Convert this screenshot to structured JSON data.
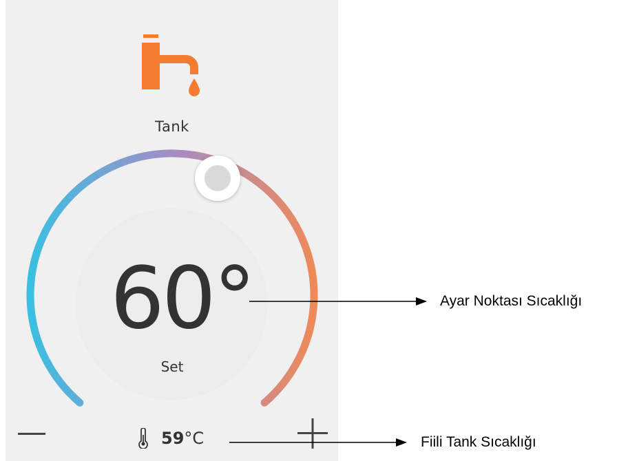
{
  "zone": {
    "name": "Tank",
    "icon": "faucet-icon"
  },
  "setpoint": {
    "value": "60°",
    "label": "Set"
  },
  "actual": {
    "value": "59",
    "unit": "°C",
    "icon": "thermometer-icon"
  },
  "controls": {
    "minus_icon": "minus-icon",
    "plus_icon": "plus-icon"
  },
  "annotations": {
    "setpoint_callout": "Ayar Noktası Sıcaklığı",
    "actual_callout": "Fiili Tank Sıcaklığı"
  },
  "colors": {
    "panel_bg": "#f0f0f0",
    "icon_orange": "#f47c30",
    "arc_cold": "#3bbfe0",
    "arc_mid": "#a58cc6",
    "arc_hot": "#ee8a5a",
    "text_dark": "#333333"
  }
}
